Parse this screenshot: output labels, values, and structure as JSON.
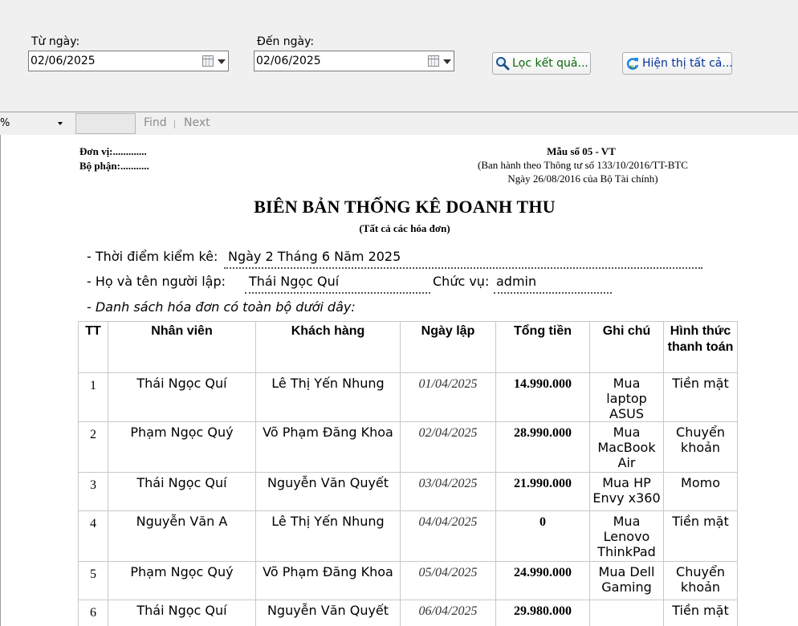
{
  "filter": {
    "from_label": "Từ ngày:",
    "from_value": "02/06/2025",
    "to_label": "Đến ngày:",
    "to_value": "02/06/2025",
    "filter_button": "Lọc kết quả...",
    "filter_icon": "search-icon",
    "show_all_button": "Hiện thị tất cả...",
    "show_all_icon": "refresh-icon"
  },
  "toolbar": {
    "zoom": "%",
    "find": "Find",
    "next": "Next"
  },
  "report": {
    "unit": "Đơn vị:.............",
    "department": "Bộ phận:...........",
    "form_no": "Mẫu số 05 - VT",
    "form_issued": "(Ban hành theo Thông tư số 133/10/2016/TT-BTC",
    "form_date": "Ngày 26/08/2016 của Bộ Tài chính)",
    "title": "BIÊN BẢN THỐNG KÊ DOANH THU",
    "subtitle": "(Tất cả các hóa đơn)",
    "time_label": "- Thời điểm kiểm kê:",
    "time_value": "Ngày 2 Tháng 6 Năm 2025",
    "creator_label": "- Họ và tên người lập:",
    "creator_value": "Thái Ngọc Quí",
    "position_label": "Chức vụ:",
    "position_value": "admin",
    "list_label": "- Danh sách hóa đơn có toàn bộ dưới dây:",
    "columns": [
      "TT",
      "Nhân viên",
      "Khách hàng",
      "Ngày lập",
      "Tổng tiền",
      "Ghi chú",
      "Hình thức thanh toán"
    ],
    "rows": [
      {
        "tt": "1",
        "nv": "Thái Ngọc Quí",
        "kh": "Lê Thị Yến Nhung",
        "date": "01/04/2025",
        "money": "14.990.000",
        "note": "Mua laptop ASUS",
        "pay": "Tiền mặt"
      },
      {
        "tt": "2",
        "nv": "Phạm Ngọc Quý",
        "kh": "Võ Phạm Đăng Khoa",
        "date": "02/04/2025",
        "money": "28.990.000",
        "note": "Mua MacBook Air",
        "pay": "Chuyển khoản"
      },
      {
        "tt": "3",
        "nv": "Thái Ngọc Quí",
        "kh": "Nguyễn Văn Quyết",
        "date": "03/04/2025",
        "money": "21.990.000",
        "note": "Mua HP Envy x360",
        "pay": "Momo"
      },
      {
        "tt": "4",
        "nv": "Nguyễn Văn A",
        "kh": "Lê Thị Yến Nhung",
        "date": "04/04/2025",
        "money": "0",
        "note": "Mua Lenovo ThinkPad",
        "pay": "Tiền mặt"
      },
      {
        "tt": "5",
        "nv": "Phạm Ngọc Quý",
        "kh": "Võ Phạm Đăng Khoa",
        "date": "05/04/2025",
        "money": "24.990.000",
        "note": "Mua Dell Gaming",
        "pay": "Chuyển khoản"
      },
      {
        "tt": "6",
        "nv": "Thái Ngọc Quí",
        "kh": "Nguyễn Văn Quyết",
        "date": "06/04/2025",
        "money": "29.980.000",
        "note": "",
        "pay": "Tiền mặt"
      }
    ]
  }
}
